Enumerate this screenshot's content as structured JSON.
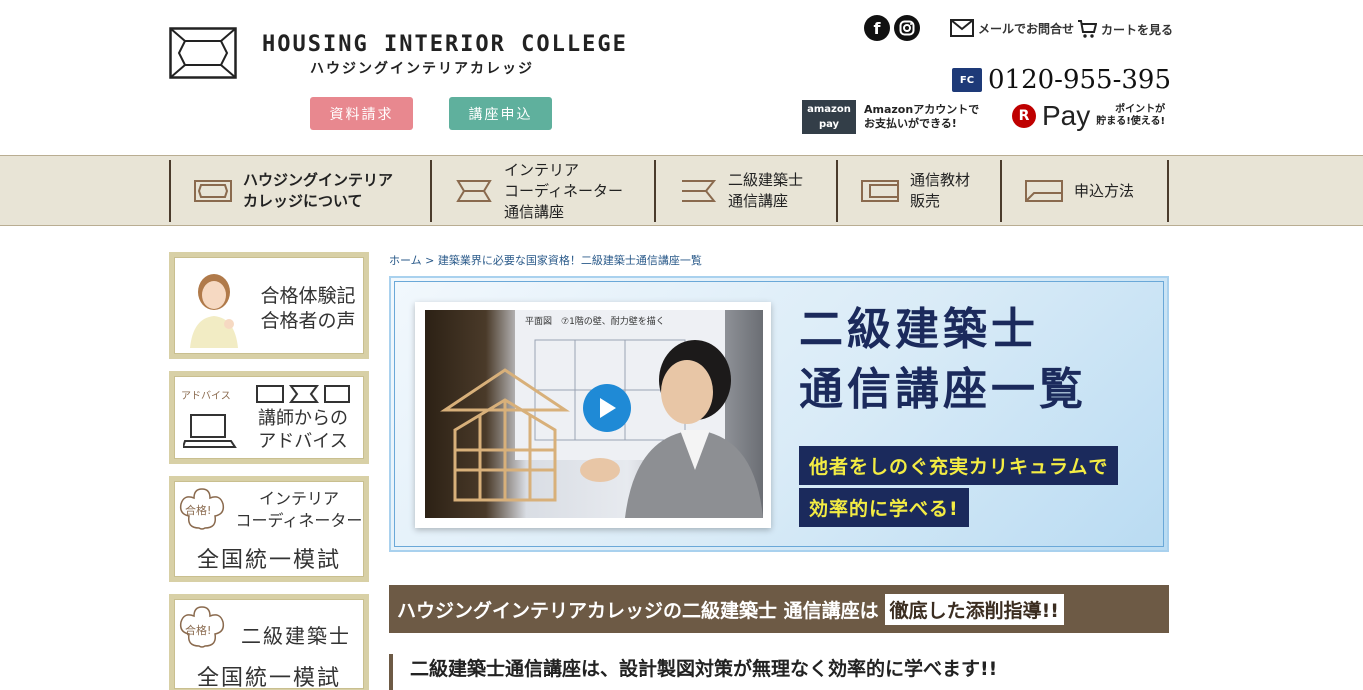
{
  "header": {
    "logo_en": "HOUSING INTERIOR COLLEGE",
    "logo_ja": "ハウジングインテリアカレッジ",
    "request_button": "資料請求",
    "apply_button": "講座申込",
    "facebook_glyph": "f",
    "instagram_glyph": "◎",
    "mail_link": "メールでお問合せ",
    "cart_link": "カートを見る",
    "freecall_badge": "FC",
    "phone": "0120-955-395",
    "amazon_logo_top": "amazon",
    "amazon_logo_bottom": "pay",
    "amazon_text_1": "Amazonアカウントで",
    "amazon_text_2": "お支払いができる!",
    "rpay_r": "R",
    "rpay_word": "Pay",
    "rpay_text_1": "ポイントが",
    "rpay_text_2": "貯まる!使える!"
  },
  "nav": {
    "items": [
      {
        "line1": "ハウジングインテリア",
        "line2": "カレッジについて",
        "line3": ""
      },
      {
        "line1": "インテリア",
        "line2": "コーディネーター",
        "line3": "通信講座"
      },
      {
        "line1": "二級建築士",
        "line2": "通信講座",
        "line3": ""
      },
      {
        "line1": "通信教材",
        "line2": "販売",
        "line3": ""
      },
      {
        "line1": "申込方法",
        "line2": "",
        "line3": ""
      }
    ]
  },
  "sidebar": {
    "card1": {
      "line1": "合格体験記",
      "line2": "合格者の声"
    },
    "card2": {
      "tag": "アドバイス",
      "line1": "講師からの",
      "line2": "アドバイス"
    },
    "card3": {
      "badge": "合格!",
      "line1": "インテリア",
      "line2": "コーディネーター",
      "line3": "全国統一模試"
    },
    "card4": {
      "badge": "合格!",
      "line1": "二級建築士",
      "line2": "全国統一模試"
    }
  },
  "breadcrumb": {
    "home": "ホーム",
    "separator": ">",
    "current": "建築業界に必要な国家資格！二級建築士通信講座一覧"
  },
  "hero": {
    "title_line1": "二級建築士",
    "title_line2": "通信講座一覧",
    "band1": "他者をしのぐ充実カリキュラムで",
    "band2": "効率的に学べる!",
    "video_caption": "平面図　⑦1階の壁、耐力壁を描く"
  },
  "banner": {
    "text": "ハウジングインテリアカレッジの二級建築士 通信講座は",
    "highlight": "徹底した添削指導!!"
  },
  "lead": {
    "text": "二級建築士通信講座は、設計製図対策が無理なく効率的に学べます!!"
  },
  "colors": {
    "pink_button": "#e8888f",
    "green_button": "#5fb09d",
    "nav_bg": "#e8e4d6",
    "navy": "#1b2a5c",
    "yellow": "#f3ec43",
    "brown": "#6d5a45",
    "play": "#1f8ad6"
  }
}
